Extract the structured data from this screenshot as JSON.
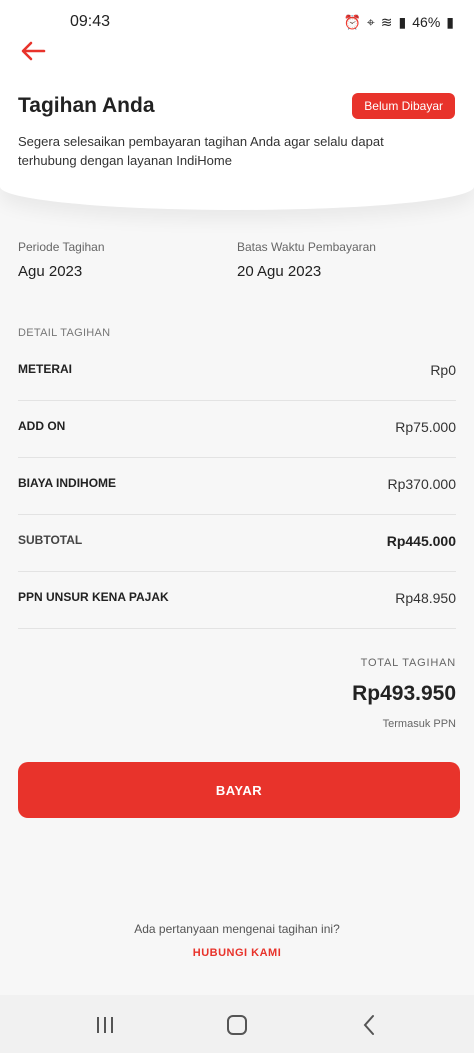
{
  "status_bar": {
    "time": "09:43",
    "battery": "46%"
  },
  "header": {
    "title": "Tagihan Anda",
    "badge": "Belum Dibayar",
    "subtitle": "Segera selesaikan pembayaran tagihan Anda agar selalu dapat terhubung dengan layanan IndiHome"
  },
  "billing": {
    "period_label": "Periode Tagihan",
    "period_value": "Agu 2023",
    "deadline_label": "Batas Waktu Pembayaran",
    "deadline_value": "20 Agu 2023"
  },
  "detail": {
    "section_label": "DETAIL TAGIHAN",
    "rows": [
      {
        "label": "METERAI",
        "value": "Rp0"
      },
      {
        "label": "ADD ON",
        "value": "Rp75.000"
      },
      {
        "label": "BIAYA INDIHOME",
        "value": "Rp370.000"
      },
      {
        "label": "SUBTOTAL",
        "value": "Rp445.000"
      },
      {
        "label": "PPN UNSUR KENA PAJAK",
        "value": "Rp48.950"
      }
    ]
  },
  "total": {
    "label": "TOTAL TAGIHAN",
    "value": "Rp493.950",
    "note": "Termasuk PPN"
  },
  "actions": {
    "pay_label": "BAYAR",
    "question": "Ada pertanyaan mengenai tagihan ini?",
    "contact_label": "HUBUNGI KAMI"
  },
  "colors": {
    "accent": "#e8332b"
  },
  "icons": [
    "back-arrow-icon",
    "recent-apps-icon",
    "home-icon",
    "nav-back-icon"
  ]
}
